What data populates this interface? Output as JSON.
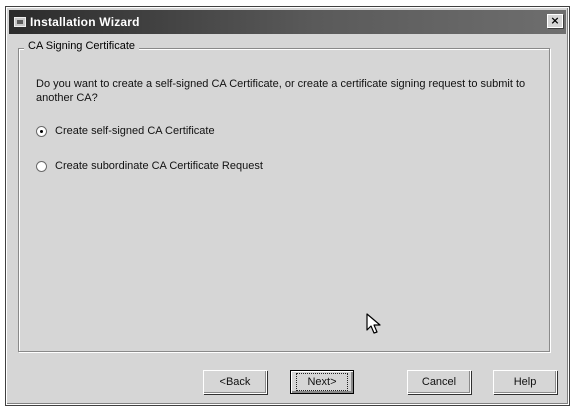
{
  "window": {
    "title": "Installation Wizard",
    "close_glyph": "×"
  },
  "group": {
    "legend": "CA Signing Certificate",
    "prompt": "Do you want to create a self-signed CA Certificate, or create a certificate signing request to submit to another CA?"
  },
  "options": [
    {
      "label": "Create self-signed CA Certificate",
      "selected": true
    },
    {
      "label": "Create subordinate CA Certificate Request",
      "selected": false
    }
  ],
  "buttons": {
    "back": "<Back",
    "next": "Next>",
    "cancel": "Cancel",
    "help": "Help"
  },
  "icons": {
    "app": "wizard-app-icon",
    "close": "close-icon",
    "cursor": "mouse-pointer-icon"
  }
}
